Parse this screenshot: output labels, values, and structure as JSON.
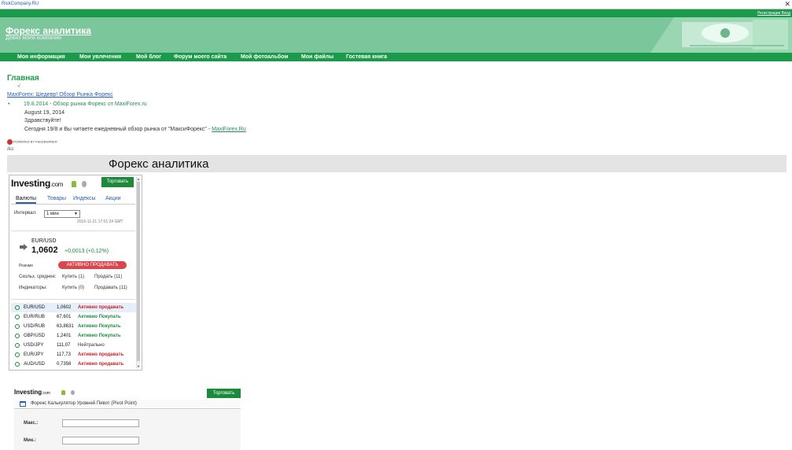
{
  "browser": {
    "site": "RiskCompany.RU",
    "close_glyph": "✕"
  },
  "topline": {
    "register": "Регистрация Вход"
  },
  "header": {
    "title": "Форекс аналитика",
    "subtitle": "Девиз моей компании"
  },
  "nav": {
    "items": [
      {
        "label": "Моя информация"
      },
      {
        "label": "Мои увлечения"
      },
      {
        "label": "Мой блог"
      },
      {
        "label": "Форум моего сайта"
      },
      {
        "label": "Мой фотоальбом"
      },
      {
        "label": "Мои файлы"
      },
      {
        "label": "Гостевая книга"
      }
    ]
  },
  "page": {
    "heading": "Главная",
    "small_mark": "‹/",
    "breadcrumb": "MaxiForex: Шедевр! Обзор Рынка Форекс",
    "news": {
      "link": "19.8.2014 - Обзор рынка Форекс от MaxiForex.ru",
      "date": "August 19, 2014",
      "greeting": "Здравствуйте!",
      "body": "Сегодня 19/8 и Вы читаете ежедневный обзор рынка от \"МаксиФорекс\" -",
      "maxi_link": "MaxiForex.Ru"
    },
    "powered": "POWERED BY FEEDBURNER",
    "index_text": "/ёз:",
    "banner_title": "Форекс аналитика"
  },
  "widget": {
    "logo_main": "Investing",
    "logo_tld": ".com",
    "trade_button": "Торговать",
    "tabs": [
      {
        "label": "Валюты"
      },
      {
        "label": "Товары"
      },
      {
        "label": "Индексы"
      },
      {
        "label": "Акции"
      }
    ],
    "interval_label": "Интервал:",
    "interval_value": "1 мин",
    "caret": "▼",
    "timestamp": "2016-11-21 17:01:24 GMT",
    "pair": "EUR/USD",
    "price": "1,0602",
    "change": "+0,0013 (+0,12%)",
    "summary_label": "Резюме",
    "summary_value": "АКТИВНО ПРОДАВАТЬ",
    "moving_label": "Скольз. среднее:",
    "moving_buy": "Купить (1)",
    "moving_sell": "Продать (11)",
    "indicators_label": "Индикаторы:",
    "indicators_buy": "Купить (0)",
    "indicators_sell": "Продавать (11)",
    "rows": [
      {
        "symbol": "EUR/USD",
        "price": "1,0602",
        "signal": "Активно продавать",
        "type": "sell"
      },
      {
        "symbol": "EUR/RUB",
        "price": "67,601",
        "signal": "Активно Покупать",
        "type": "buy"
      },
      {
        "symbol": "USD/RUB",
        "price": "63,8631",
        "signal": "Активно Покупать",
        "type": "buy"
      },
      {
        "symbol": "GBP/USD",
        "price": "1,2401",
        "signal": "Активно Покупать",
        "type": "buy"
      },
      {
        "symbol": "USD/JPY",
        "price": "111,07",
        "signal": "Нейтрально",
        "type": "neutral"
      },
      {
        "symbol": "EUR/JPY",
        "price": "117,73",
        "signal": "Активно продавать",
        "type": "sell"
      },
      {
        "symbol": "AUD/USD",
        "price": "0,7358",
        "signal": "Активно продавать",
        "type": "sell"
      }
    ],
    "scroll_up": "▲",
    "scroll_down": "▼"
  },
  "pivot": {
    "logo_main": "Investing",
    "logo_tld": ".com",
    "trade_button": "Торговать",
    "title": "Форекс Калькулятор Уровней Пивот (Pivot Point)",
    "max_label": "Макс.:",
    "min_label": "Мин.:"
  },
  "colors": {
    "green": "#1c9a4c",
    "header_bg": "#7cc69b",
    "sell": "#c8202a",
    "buy": "#1c8a3a"
  }
}
